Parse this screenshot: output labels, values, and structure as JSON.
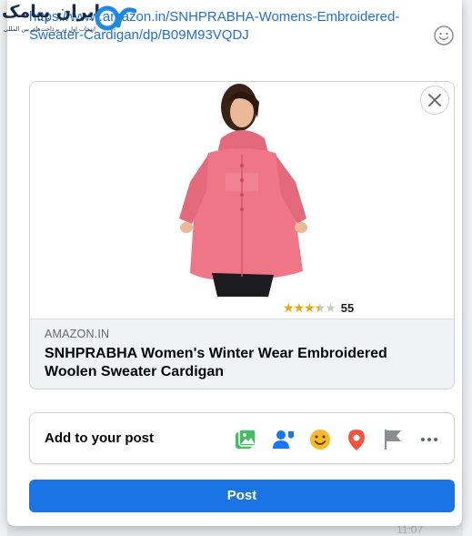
{
  "logo": {
    "text": "ایران پیامک",
    "subtitle": "انتخاب اول در پرداخت‌های بین المللی"
  },
  "composer": {
    "link_text": "https://www.amazon.in/SNHPRABHA-Womens-Embroidered-Sweater-Cardigan/dp/B09M93VQDJ",
    "link_display": "https://www.amazon.in/SNHPRABHA-Womens-Embroidered-Sweater-Cardigan/dp/B09M93VQDJ"
  },
  "link_preview": {
    "domain": "AMAZON.IN",
    "title": "SNHPRABHA Women's Winter Wear Embroidered Woolen Sweater Cardigan",
    "rating_value": 3.5,
    "rating_max": 5,
    "review_count": "55",
    "image_alt": "Pink embroidered woolen cardigan",
    "product_color": "#ef7686"
  },
  "add_to_post": {
    "label": "Add to your post",
    "icons": [
      "photo-video-icon",
      "tag-people-icon",
      "feeling-icon",
      "check-in-icon",
      "flag-icon",
      "more-icon"
    ]
  },
  "post_button": {
    "label": "Post"
  },
  "colors": {
    "accent": "#1b74e4",
    "link": "#216fdb"
  },
  "background_timestamp": "11:07"
}
